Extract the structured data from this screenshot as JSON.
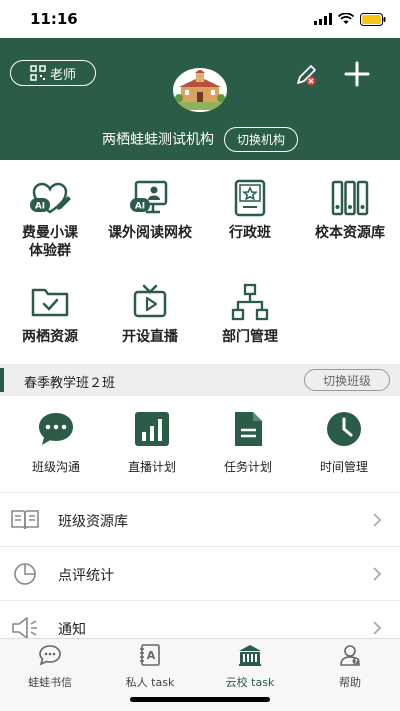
{
  "status": {
    "time": "11:16"
  },
  "header": {
    "teacher_label": "老师",
    "org_name": "两栖蛙蛙测试机构",
    "switch_org": "切换机构",
    "bg_color": "#2a5c48"
  },
  "features": [
    {
      "label": "费曼小课\n体验群",
      "icon": "ai-heart-icon"
    },
    {
      "label": "课外阅读网校",
      "icon": "ai-monitor-icon"
    },
    {
      "label": "行政班",
      "icon": "certificate-icon"
    },
    {
      "label": "校本资源库",
      "icon": "binders-icon"
    },
    {
      "label": "两栖资源",
      "icon": "folder-check-icon"
    },
    {
      "label": "开设直播",
      "icon": "tv-play-icon"
    },
    {
      "label": "部门管理",
      "icon": "org-chart-icon"
    }
  ],
  "class_bar": {
    "class_name": "春季教学班２班",
    "switch_class": "切换班级"
  },
  "class_functions": [
    {
      "label": "班级沟通",
      "icon": "chat-bubble-icon"
    },
    {
      "label": "直播计划",
      "icon": "bar-chart-icon"
    },
    {
      "label": "任务计划",
      "icon": "document-icon"
    },
    {
      "label": "时间管理",
      "icon": "clock-icon"
    }
  ],
  "list": [
    {
      "label": "班级资源库",
      "icon": "book-open-icon"
    },
    {
      "label": "点评统计",
      "icon": "pie-chart-icon"
    },
    {
      "label": "通知",
      "icon": "speaker-icon"
    }
  ],
  "tabs": [
    {
      "label": "蛙蛙书信",
      "icon": "chat-icon",
      "active": false
    },
    {
      "label": "私人 task",
      "icon": "notebook-icon",
      "active": false
    },
    {
      "label": "云校 task",
      "icon": "school-icon",
      "active": true
    },
    {
      "label": "帮助",
      "icon": "help-user-icon",
      "active": false
    }
  ]
}
